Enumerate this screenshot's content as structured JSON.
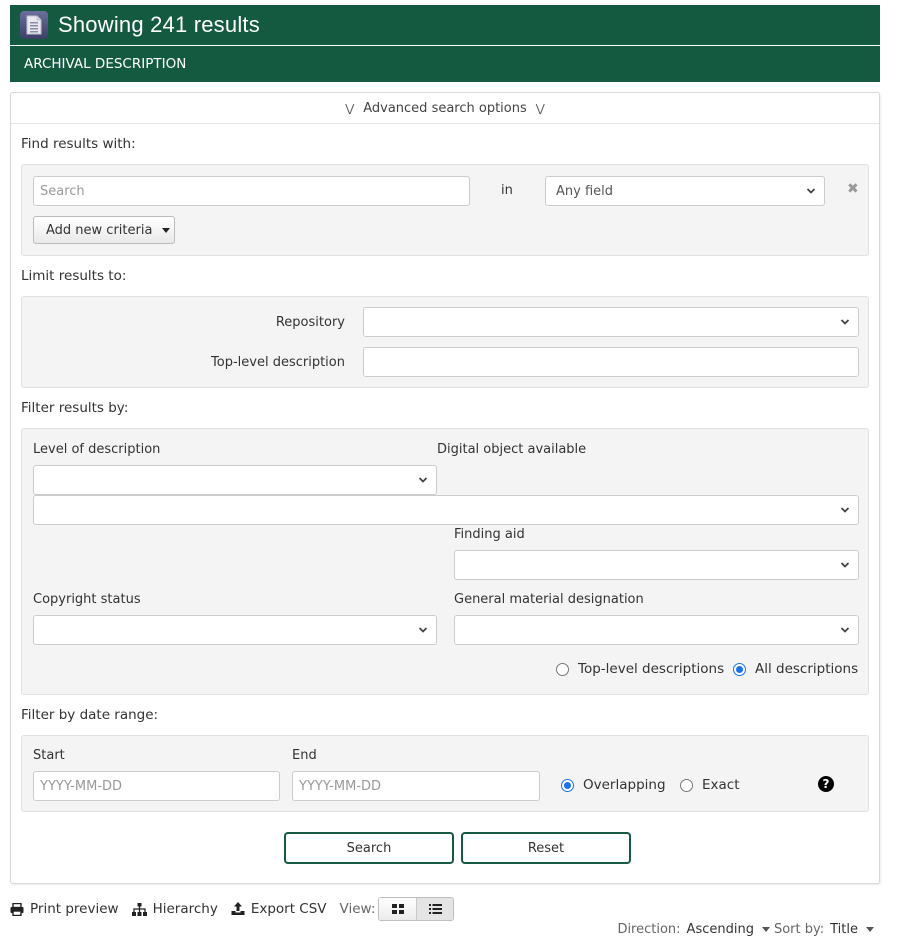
{
  "header": {
    "title": "Showing 241 results",
    "subtitle": "ARCHIVAL DESCRIPTION",
    "icon": "document-icon",
    "brand_color": "#145a41"
  },
  "advanced": {
    "toggle_label": "Advanced search options",
    "find_label": "Find results with:",
    "search_placeholder": "Search",
    "in_label": "in",
    "field_select_value": "Any field",
    "add_criteria_label": "Add new criteria",
    "limit_label": "Limit results to:",
    "repository_label": "Repository",
    "repository_value": "",
    "top_level_label": "Top-level description",
    "top_level_value": "",
    "filter_label": "Filter results by:",
    "level_label": "Level of description",
    "digital_object_label": "Digital object available",
    "finding_aid_label": "Finding aid",
    "copyright_label": "Copyright status",
    "gmd_label": "General material designation",
    "scope_options": [
      {
        "label": "Top-level descriptions",
        "checked": false
      },
      {
        "label": "All descriptions",
        "checked": true
      }
    ],
    "date_label": "Filter by date range:",
    "start_label": "Start",
    "start_placeholder": "YYYY-MM-DD",
    "end_label": "End",
    "end_placeholder": "YYYY-MM-DD",
    "date_options": [
      {
        "label": "Overlapping",
        "checked": true
      },
      {
        "label": "Exact",
        "checked": false
      }
    ],
    "help_icon": "question-circle-icon",
    "search_button": "Search",
    "reset_button": "Reset"
  },
  "toolbar": {
    "print_label": "Print preview",
    "hierarchy_label": "Hierarchy",
    "export_label": "Export CSV",
    "view_label": "View:",
    "view_options": [
      "card-view",
      "table-view"
    ],
    "active_view": "table-view"
  },
  "sort": {
    "direction_label": "Direction:",
    "direction_value": "Ascending",
    "sort_label": "Sort by:",
    "sort_value": "Title"
  }
}
